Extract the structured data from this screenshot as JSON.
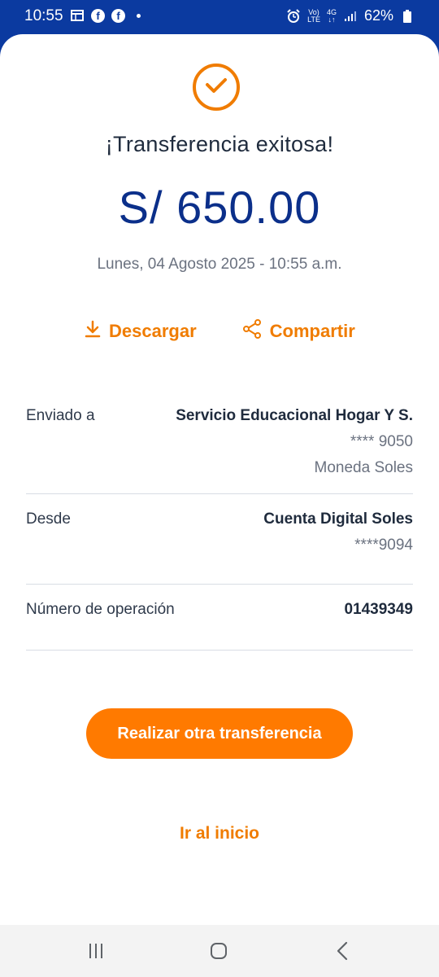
{
  "status_bar": {
    "time": "10:55",
    "battery": "62%",
    "network_top": "Vo)",
    "network_bottom": "LTE",
    "signal_top": "4G"
  },
  "receipt": {
    "title": "¡Transferencia exitosa!",
    "amount": "S/ 650.00",
    "datetime": "Lunes, 04 Agosto 2025 - 10:55 a.m."
  },
  "actions": {
    "download_label": "Descargar",
    "share_label": "Compartir"
  },
  "details": {
    "sent_to": {
      "label": "Enviado a",
      "name": "Servicio Educacional Hogar Y S.",
      "account": "**** 9050",
      "currency": "Moneda Soles"
    },
    "from": {
      "label": "Desde",
      "name": "Cuenta Digital Soles",
      "account": "****9094"
    },
    "operation": {
      "label": "Número de operación",
      "number": "01439349"
    }
  },
  "buttons": {
    "new_transfer": "Realizar otra transferencia",
    "home": "Ir al inicio"
  },
  "colors": {
    "brand_blue": "#0b3aa0",
    "accent_orange": "#ff7a00",
    "amount_blue": "#0b2f8a"
  }
}
